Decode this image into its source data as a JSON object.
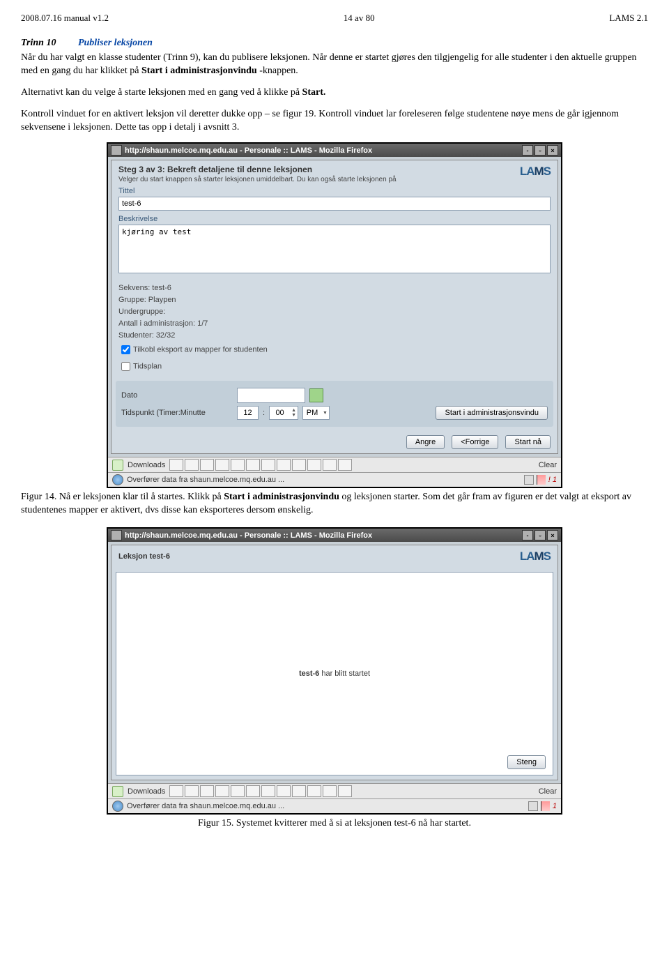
{
  "header": {
    "left": "2008.07.16 manual v1.2",
    "center": "14 av 80",
    "right": "LAMS 2.1"
  },
  "section": {
    "step": "Trinn 10",
    "step_name": "Publiser leksjonen",
    "para1_a": "Når du har valgt en klasse studenter (Trinn 9), kan du publisere leksjonen. Når denne er startet gjøres den tilgjengelig for alle studenter i den aktuelle gruppen med en gang du har klikket på ",
    "para1_bold": "Start i administrasjonvindu",
    "para1_b": " -knappen.",
    "para2_a": "Alternativt kan du velge å starte leksjonen med en gang ved å klikke på ",
    "para2_bold": "Start.",
    "para3": "Kontroll vinduet for en aktivert leksjon vil deretter dukke opp – se figur 19. Kontroll vinduet lar foreleseren følge studentene nøye mens de går igjennom sekvensene i leksjonen. Dette tas opp i detalj i avsnitt 3."
  },
  "win1": {
    "title": "http://shaun.melcoe.mq.edu.au - Personale :: LAMS - Mozilla Firefox",
    "header_title": "Steg 3 av 3: Bekreft detaljene til denne leksjonen",
    "header_sub": "Velger du start knappen så starter leksjonen umiddelbart. Du kan også starte leksjonen på",
    "logo": "LAMS",
    "label_title": "Tittel",
    "value_title": "test-6",
    "label_desc": "Beskrivelse",
    "value_desc": "kjøring av test",
    "info": {
      "line1": "Sekvens: test-6",
      "line2": "Gruppe: Playpen",
      "line3": "Undergruppe:",
      "line4": "Antall i administrasjon: 1/7",
      "line5": "Studenter: 32/32",
      "chk1": "Tilkobl eksport av mapper for studenten",
      "chk2": "Tidsplan",
      "dato_label": "Dato",
      "time_label": "Tidspunkt (Timer:Minutte",
      "hour": "12",
      "min": "00",
      "ampm": "PM"
    },
    "btn_start_admin": "Start i administrasjonsvindu",
    "btn_angre": "Angre",
    "btn_prev": "<Forrige",
    "btn_start": "Start  nå",
    "downloads": "Downloads",
    "clear": "Clear",
    "status": "Overfører data fra shaun.melcoe.mq.edu.au ...",
    "status_warn": "!   1"
  },
  "fig14_a": "Figur 14. Nå er leksjonen klar til å startes. Klikk på ",
  "fig14_bold": "Start i administrasjonvindu",
  "fig14_b": " og leksjonen starter. Som det går fram av figuren er det valgt at eksport av studentenes mapper er aktivert, dvs disse kan eksporteres dersom ønskelig.",
  "win2": {
    "title": "http://shaun.melcoe.mq.edu.au - Personale :: LAMS - Mozilla Firefox",
    "lesson": "Leksjon test-6",
    "logo": "LAMS",
    "msg_bold": "test-6",
    "msg_rest": " har blitt startet",
    "steng": "Steng",
    "downloads": "Downloads",
    "clear": "Clear",
    "status": "Overfører data fra shaun.melcoe.mq.edu.au ...",
    "status_warn": "1"
  },
  "fig15": "Figur 15. Systemet kvitterer med å si at leksjonen test-6 nå har startet."
}
